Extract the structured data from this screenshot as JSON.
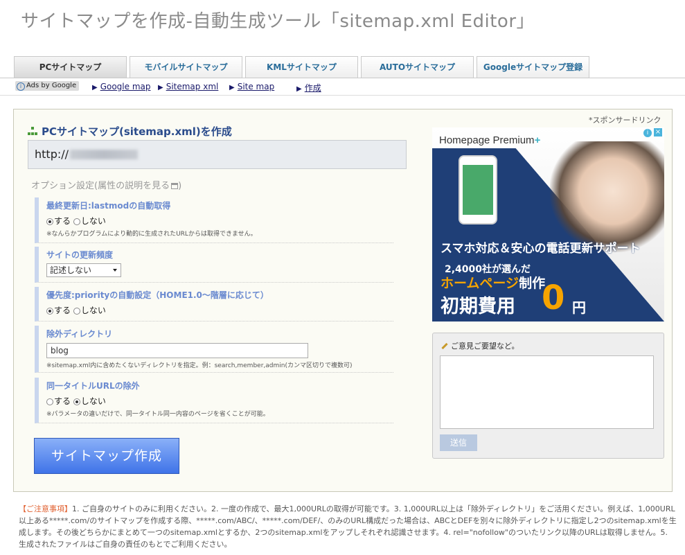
{
  "page_title": "サイトマップを作成-自動生成ツール「sitemap.xml Editor」",
  "tabs": [
    {
      "label": "PCサイトマップ",
      "active": true
    },
    {
      "label": "モバイルサイトマップ",
      "active": false
    },
    {
      "label": "KMLサイトマップ",
      "active": false
    },
    {
      "label": "AUTOサイトマップ",
      "active": false
    },
    {
      "label": "Googleサイトマップ登録",
      "active": false
    }
  ],
  "subnav": {
    "ads_label": "Ads by Google",
    "links": [
      "Google map",
      "Sitemap xml",
      "Site map",
      "作成"
    ]
  },
  "form": {
    "section_title": "PCサイトマップ(sitemap.xml)を作成",
    "url_value": "http://",
    "options_title": "オプション設定(属性の説明を見る",
    "options_title_end": ")",
    "lastmod": {
      "label": "最終更新日:lastmodの自動取得",
      "yes": "する",
      "no": "しない",
      "note": "※なんらかプログラムにより動的に生成されたURLからは取得できません。"
    },
    "changefreq": {
      "label": "サイトの更新頻度",
      "selected": "記述しない"
    },
    "priority": {
      "label": "優先度:priorityの自動設定（HOME1.0～階層に応じて）",
      "yes": "する",
      "no": "しない"
    },
    "exclude_dir": {
      "label": "除外ディレクトリ",
      "value": "blog",
      "note": "※sitemap.xml内に含めたくないディレクトリを指定。例：search,member,admin(カンマ区切りで複数可)"
    },
    "same_title": {
      "label": "同一タイトルURLの除外",
      "yes": "する",
      "no": "しない",
      "note": "※パラメータの違いだけで、同一タイトル同一内容のページを省くことが可能。"
    },
    "submit_label": "サイトマップ作成"
  },
  "sponsor_label": "*スポンサードリンク",
  "ad": {
    "brand": "Homepage Premium",
    "headline": "スマホ対応＆安心の電話更新サポート",
    "line1": "2,4000社が選んだ",
    "line2a": "ホームページ",
    "line2b": "制作",
    "line3": "初期費用",
    "zero": "0",
    "yen": "円"
  },
  "feedback": {
    "title": "ご意見ご要望など。",
    "send_label": "送信"
  },
  "notice": {
    "label": "【ご注意事項】",
    "text": "1. ご自身のサイトのみに利用ください。2. 一度の作成で、最大1,000URLの取得が可能です。3. 1,000URL以上は「除外ディレクトリ」をご活用ください。例えば、1,000URL以上ある*****.com/のサイトマップを作成する際、*****.com/ABC/、*****.com/DEF/、のみのURL構成だった場合は、ABCとDEFを別々に除外ディレクトリに指定し2つのsitemap.xmlを生成します。その後どちらかにまとめて一つのsitemap.xmlとするか、2つのsitemap.xmlをアップしそれぞれ認識させます。4. rel=\"nofollow\"のついたリンク以降のURLは取得しません。5. 生成されたファイルはご自身の責任のもとでご利用ください。"
  }
}
